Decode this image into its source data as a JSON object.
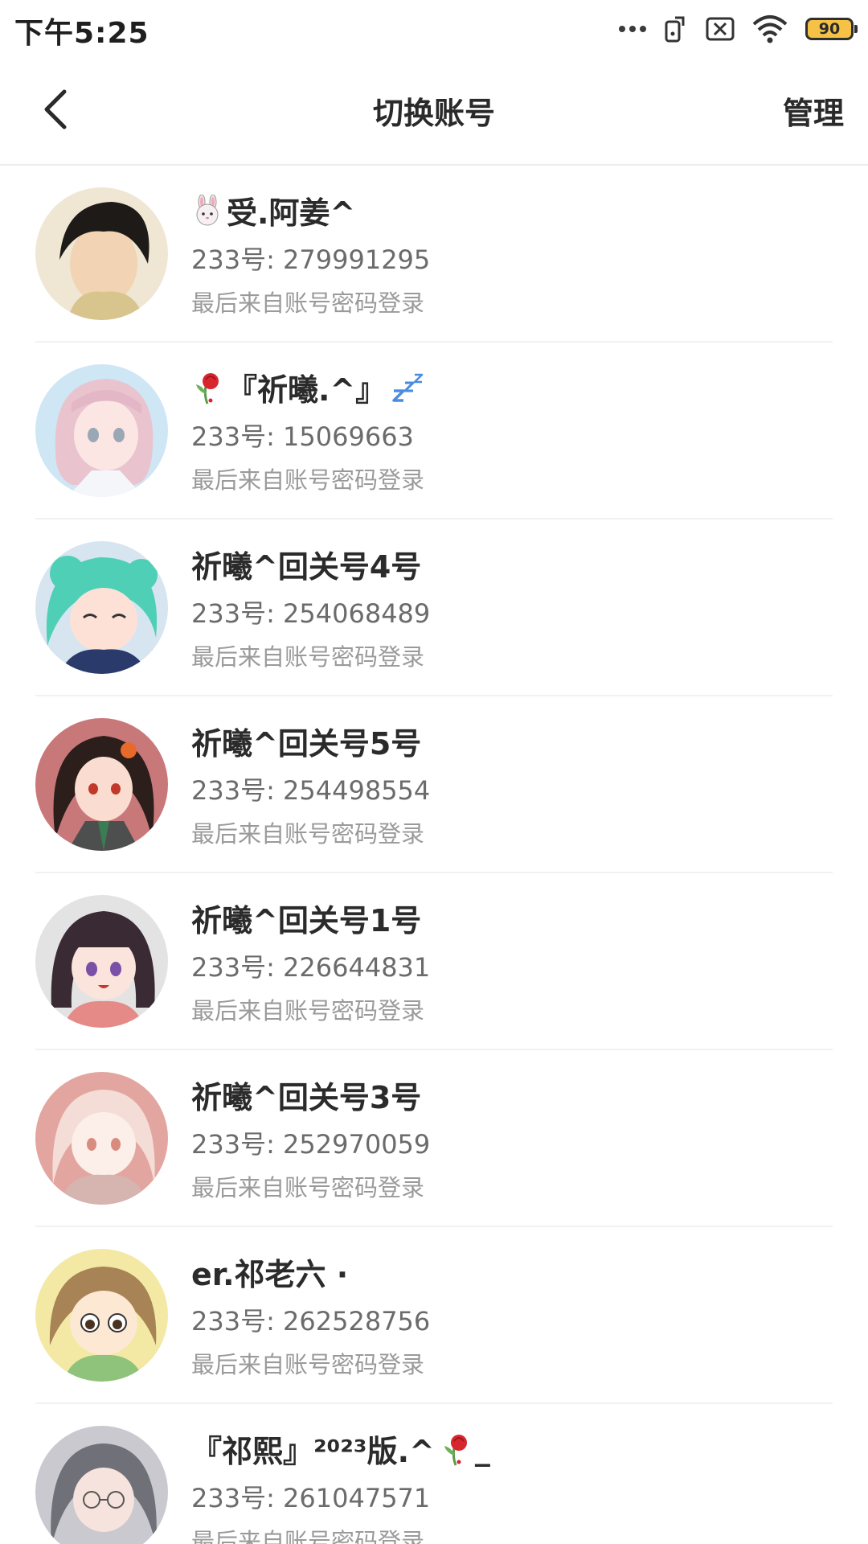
{
  "status_bar": {
    "time": "下午5:25",
    "battery_level": "90",
    "icons": [
      "more-dots-icon",
      "screen-rotate-icon",
      "sim-off-icon",
      "wifi-icon",
      "battery-icon"
    ]
  },
  "header": {
    "title": "切换账号",
    "manage_label": "管理",
    "back_icon": "chevron-left-icon"
  },
  "accounts": [
    {
      "prefix_icon": "rabbit-emoji-icon",
      "name": "受.阿姜^",
      "id": "233号: 279991295",
      "sub": "最后来自账号密码登录",
      "avatar_colors": [
        "#efe7d4",
        "#1e1a17",
        "#f2d3b3"
      ]
    },
    {
      "prefix_icon": "rose-emoji-icon",
      "name": "『祈曦.^』",
      "suffix_icon": "zzz-emoji-icon",
      "id": "233号: 15069663",
      "sub": "最后来自账号密码登录",
      "avatar_colors": [
        "#cfe6f4",
        "#e9c4cf",
        "#fbe6e4"
      ]
    },
    {
      "name": "祈曦^回关号4号",
      "id": "233号: 254068489",
      "sub": "最后来自账号密码登录",
      "avatar_colors": [
        "#d7e5f1",
        "#4fd0b6",
        "#fde1d6"
      ]
    },
    {
      "name": "祈曦^回关号5号",
      "id": "233号: 254498554",
      "sub": "最后来自账号密码登录",
      "avatar_colors": [
        "#c9787a",
        "#2b1e1b",
        "#fadcd0"
      ]
    },
    {
      "name": "祈曦^回关号1号",
      "id": "233号: 226644831",
      "sub": "最后来自账号密码登录",
      "avatar_colors": [
        "#e3e3e3",
        "#3a2a33",
        "#fbe4dc"
      ]
    },
    {
      "name": "祈曦^回关号3号",
      "id": "233号: 252970059",
      "sub": "最后来自账号密码登录",
      "avatar_colors": [
        "#e3a59f",
        "#f4ddd6",
        "#fceee8"
      ]
    },
    {
      "name": "er.祁老六 ·",
      "id": "233号: 262528756",
      "sub": "最后来自账号密码登录",
      "avatar_colors": [
        "#f3e9a5",
        "#a88356",
        "#fde8d4"
      ]
    },
    {
      "name": "『祁熙』²⁰²³版.^",
      "suffix_icon": "rose-emoji-icon",
      "suffix_text": "_",
      "id": "233号: 261047571",
      "sub": "最后来自账号密码登录",
      "avatar_colors": [
        "#c9c9cf",
        "#707078",
        "#f6e3dd"
      ]
    }
  ]
}
